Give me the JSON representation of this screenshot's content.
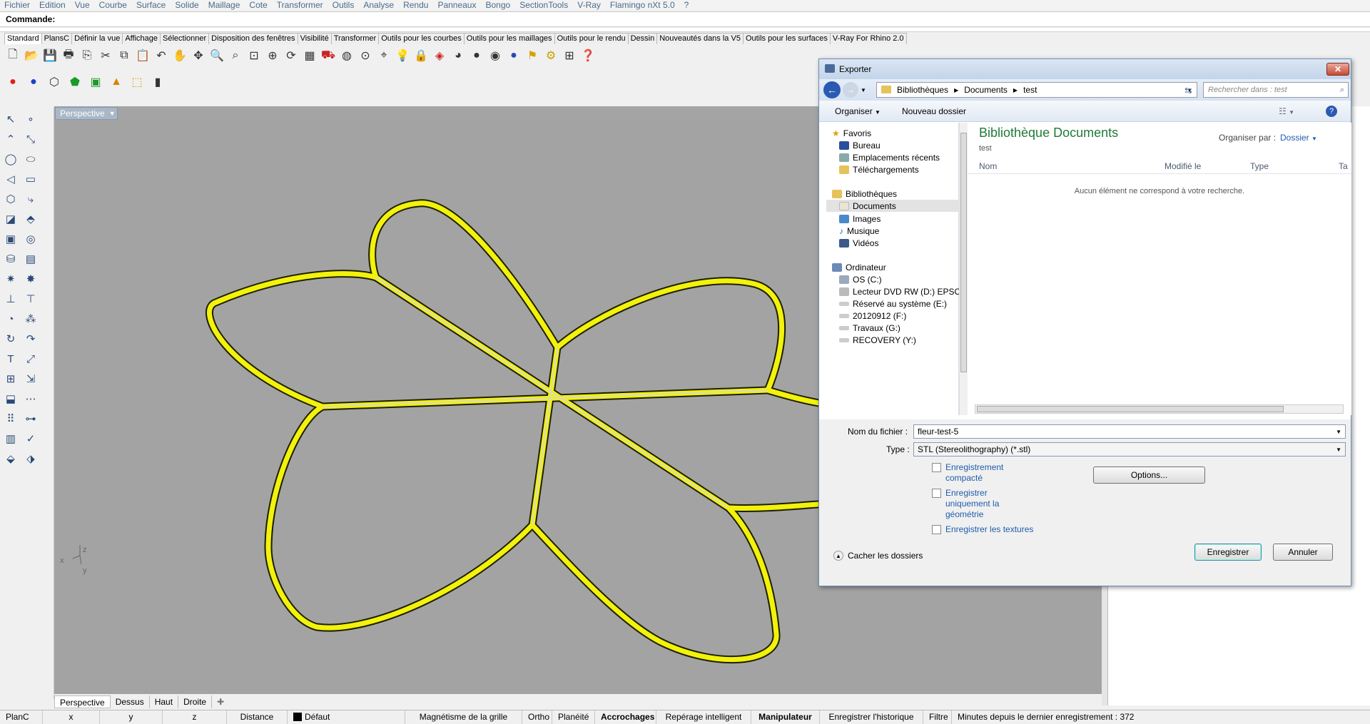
{
  "menubar": [
    "Fichier",
    "Edition",
    "Vue",
    "Courbe",
    "Surface",
    "Solide",
    "Maillage",
    "Cote",
    "Transformer",
    "Outils",
    "Analyse",
    "Rendu",
    "Panneaux",
    "Bongo",
    "SectionTools",
    "V-Ray",
    "Flamingo nXt 5.0",
    "?"
  ],
  "command": {
    "label": "Commande:"
  },
  "tabs": [
    "Standard",
    "PlansC",
    "Définir la vue",
    "Affichage",
    "Sélectionner",
    "Disposition des fenêtres",
    "Visibilité",
    "Transformer",
    "Outils pour les courbes",
    "Outils pour les maillages",
    "Outils  pour le rendu",
    "Dessin",
    "Nouveautés dans la V5",
    "Outils pour les surfaces",
    "V-Ray For Rhino 2.0"
  ],
  "viewport": {
    "title": "Perspective",
    "axes": {
      "x": "x",
      "y": "y",
      "z": "z"
    }
  },
  "bottom_tabs": [
    "Perspective",
    "Dessus",
    "Haut",
    "Droite"
  ],
  "statusbar": {
    "plan": "PlanC",
    "x": "x",
    "y": "y",
    "z": "z",
    "distance": "Distance",
    "layer": "Défaut",
    "grid": "Magnétisme de la grille",
    "ortho": "Ortho",
    "planarity": "Planéité",
    "osnap": "Accrochages",
    "smarttrack": "Repérage intelligent",
    "gumball": "Manipulateur",
    "history": "Enregistrer l'historique",
    "filter": "Filtre",
    "autosave": "Minutes depuis le dernier enregistrement : 372"
  },
  "dialog": {
    "title": "Exporter",
    "breadcrumb": [
      "Bibliothèques",
      "Documents",
      "test"
    ],
    "search_placeholder": "Rechercher dans : test",
    "organize": "Organiser",
    "new_folder": "Nouveau dossier",
    "nav": {
      "favorites": "Favoris",
      "fav_items": [
        "Bureau",
        "Emplacements récents",
        "Téléchargements"
      ],
      "libraries": "Bibliothèques",
      "lib_items": [
        "Documents",
        "Images",
        "Musique",
        "Vidéos"
      ],
      "computer": "Ordinateur",
      "drives": [
        "OS (C:)",
        "Lecteur DVD RW (D:) EPSO",
        "Réservé au système (E:)",
        "20120912 (F:)",
        "Travaux (G:)",
        "RECOVERY (Y:)"
      ]
    },
    "library_title": "Bibliothèque Documents",
    "library_sub": "test",
    "arrange_label": "Organiser par :",
    "arrange_value": "Dossier",
    "columns": [
      "Nom",
      "Modifié le",
      "Type",
      "Ta"
    ],
    "empty_message": "Aucun élément ne correspond à votre recherche.",
    "filename_label": "Nom du fichier :",
    "filename_value": "fleur-test-5",
    "type_label": "Type :",
    "type_value": "STL (Stereolithography) (*.stl)",
    "opt_compact": "Enregistrement compacté",
    "opt_geom": "Enregistrer uniquement la géométrie",
    "opt_textures": "Enregistrer les textures",
    "options_btn": "Options...",
    "hide_folders": "Cacher les dossiers",
    "save_btn": "Enregistrer",
    "cancel_btn": "Annuler"
  },
  "colors": {
    "curve": "#f5f50a",
    "viewport_bg": "#a3a3a3",
    "dialog_accent": "#1f7a3a"
  }
}
